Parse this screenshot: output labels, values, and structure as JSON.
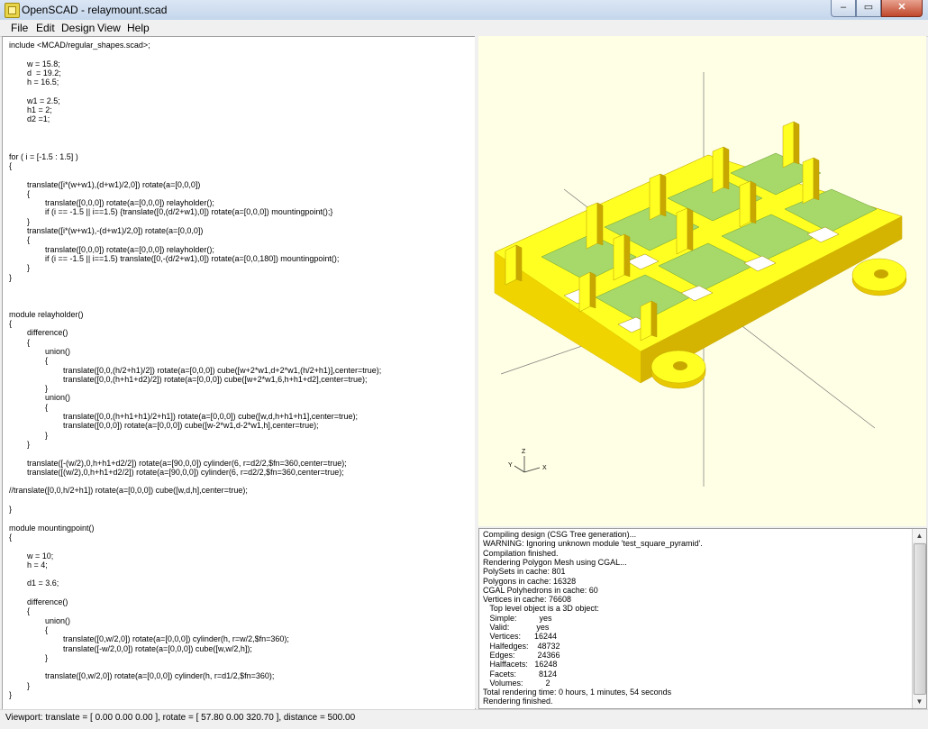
{
  "window": {
    "title": "OpenSCAD - relaymount.scad",
    "min_glyph": "–",
    "max_glyph": "▭",
    "close_glyph": "✕"
  },
  "menu": [
    "File",
    "Edit",
    "Design",
    "View",
    "Help"
  ],
  "editor": {
    "lines": [
      "include <MCAD/regular_shapes.scad>;",
      "",
      "        w = 15.8;",
      "        d  = 19.2;",
      "        h = 16.5;",
      "",
      "        w1 = 2.5;",
      "        h1 = 2;",
      "        d2 =1;",
      "",
      "",
      "",
      "for ( i = [-1.5 : 1.5] )",
      "{",
      "",
      "        translate([i*(w+w1),(d+w1)/2,0]) rotate(a=[0,0,0])",
      "        {",
      "                translate([0,0,0]) rotate(a=[0,0,0]) relayholder();",
      "                if (i == -1.5 || i==1.5) {translate([0,(d/2+w1),0]) rotate(a=[0,0,0]) mountingpoint();}",
      "        }",
      "        translate([i*(w+w1),-(d+w1)/2,0]) rotate(a=[0,0,0])",
      "        {",
      "                translate([0,0,0]) rotate(a=[0,0,0]) relayholder();",
      "                if (i == -1.5 || i==1.5) translate([0,-(d/2+w1),0]) rotate(a=[0,0,180]) mountingpoint();",
      "        }",
      "}",
      "",
      "",
      "",
      "module relayholder()",
      "{",
      "        difference()",
      "        {",
      "                union()",
      "                {",
      "                        translate([0,0,(h/2+h1)/2]) rotate(a=[0,0,0]) cube([w+2*w1,d+2*w1,(h/2+h1)],center=true);",
      "                        translate([0,0,(h+h1+d2)/2]) rotate(a=[0,0,0]) cube([w+2*w1,6,h+h1+d2],center=true);",
      "                }",
      "                union()",
      "                {",
      "                        translate([0,0,(h+h1+h1)/2+h1]) rotate(a=[0,0,0]) cube([w,d,h+h1+h1],center=true);",
      "                        translate([0,0,0]) rotate(a=[0,0,0]) cube([w-2*w1,d-2*w1,h],center=true);",
      "                }",
      "        }",
      "",
      "        translate([-(w/2),0,h+h1+d2/2]) rotate(a=[90,0,0]) cylinder(6, r=d2/2,$fn=360,center=true);",
      "        translate([(w/2),0,h+h1+d2/2]) rotate(a=[90,0,0]) cylinder(6, r=d2/2,$fn=360,center=true);",
      "",
      "//translate([0,0,h/2+h1]) rotate(a=[0,0,0]) cube([w,d,h],center=true);",
      "",
      "}",
      "",
      "module mountingpoint()",
      "{",
      "",
      "        w = 10;",
      "        h = 4;",
      "",
      "        d1 = 3.6;",
      "",
      "        difference()",
      "        {",
      "                union()",
      "                {",
      "                        translate([0,w/2,0]) rotate(a=[0,0,0]) cylinder(h, r=w/2,$fn=360);",
      "                        translate([-w/2,0,0]) rotate(a=[0,0,0]) cube([w,w/2,h]);",
      "                }",
      "",
      "                translate([0,w/2,0]) rotate(a=[0,0,0]) cylinder(h, r=d1/2,$fn=360);",
      "        }",
      "}"
    ]
  },
  "viewport": {
    "background": "#ffffe5",
    "axes": {
      "x": "X",
      "y": "Y",
      "z": "Z"
    },
    "colors": {
      "top": "#ffff00",
      "side": "#e8c800",
      "dark": "#c8a800",
      "inner": "#a6d96a"
    }
  },
  "console": {
    "lines": [
      "Compiling design (CSG Tree generation)...",
      "WARNING: Ignoring unknown module 'test_square_pyramid'.",
      "Compilation finished.",
      "Rendering Polygon Mesh using CGAL...",
      "PolySets in cache: 801",
      "Polygons in cache: 16328",
      "CGAL Polyhedrons in cache: 60",
      "Vertices in cache: 76608",
      "   Top level object is a 3D object:",
      "   Simple:          yes",
      "   Valid:            yes",
      "   Vertices:      16244",
      "   Halfedges:    48732",
      "   Edges:          24366",
      "   Halffacets:   16248",
      "   Facets:          8124",
      "   Volumes:          2",
      "Total rendering time: 0 hours, 1 minutes, 54 seconds",
      "Rendering finished."
    ]
  },
  "status": {
    "text": "Viewport: translate = [ 0.00 0.00 0.00 ], rotate = [ 57.80 0.00 320.70 ], distance = 500.00"
  }
}
